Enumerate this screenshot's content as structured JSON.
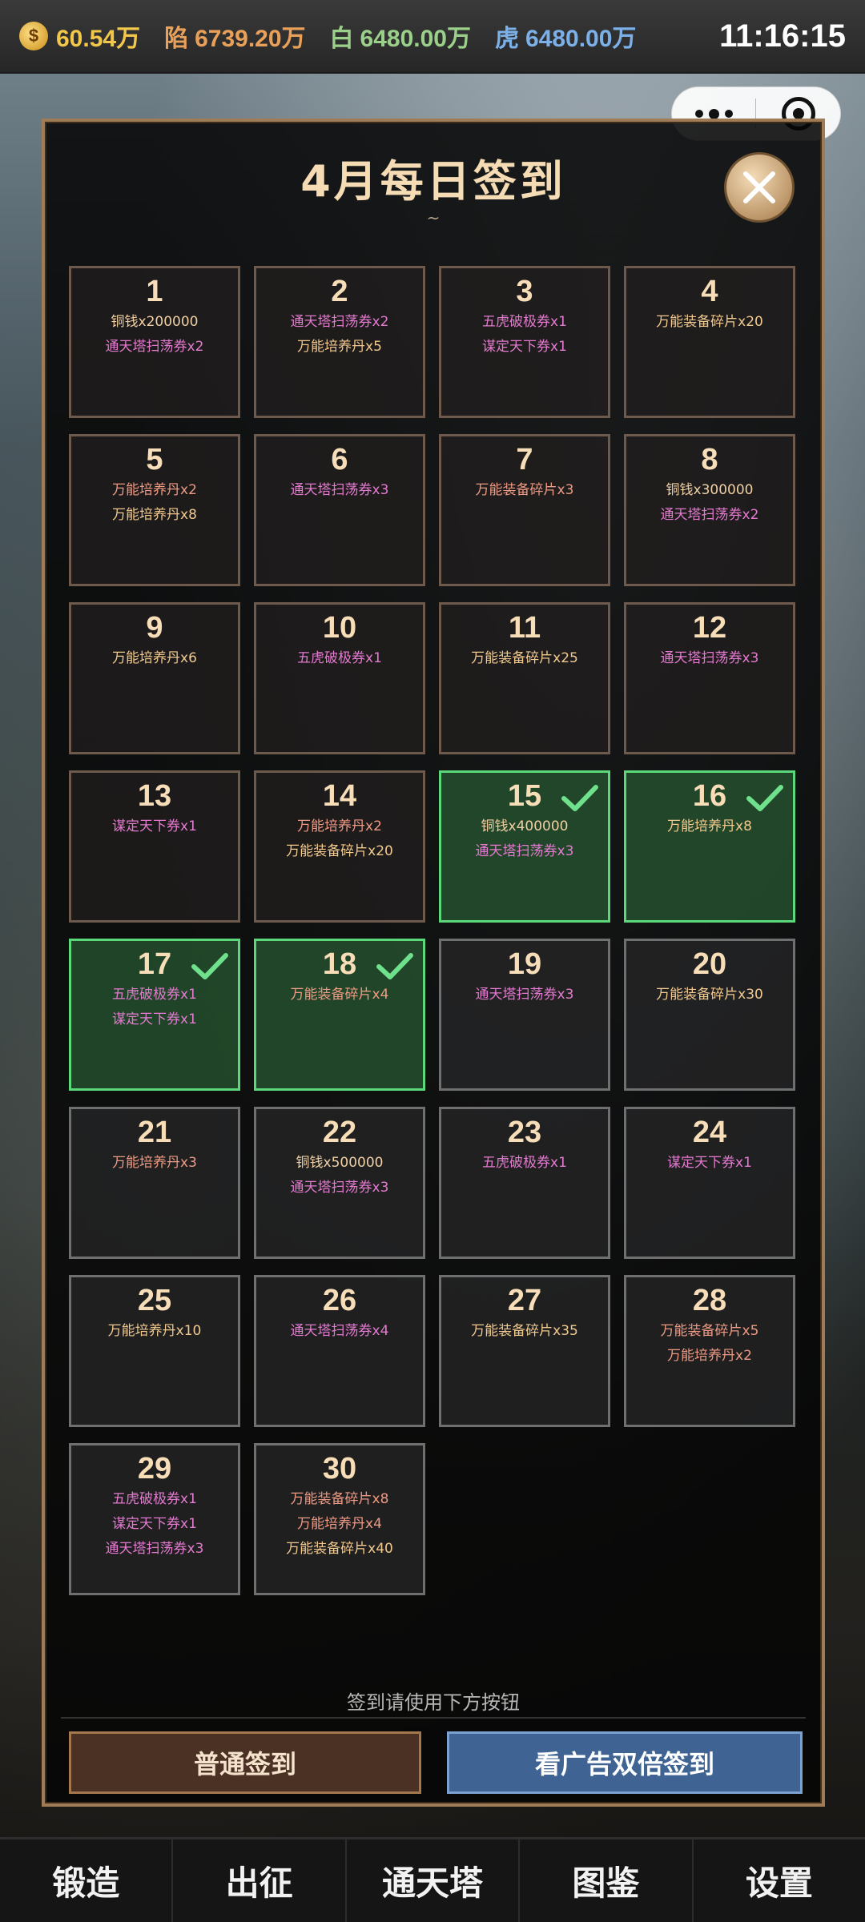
{
  "status": {
    "gold": "60.54万",
    "stats": [
      {
        "key": "陷",
        "value": "6739.20万",
        "color": "orange"
      },
      {
        "key": "白",
        "value": "6480.00万",
        "color": "green"
      },
      {
        "key": "虎",
        "value": "6480.00万",
        "color": "blue"
      }
    ],
    "time": "11:16:15"
  },
  "dialog": {
    "title": "4月每日签到",
    "tilde": "~",
    "hint": "签到请使用下方按钮",
    "btn_normal": "普通签到",
    "btn_ad": "看广告双倍签到"
  },
  "days": [
    {
      "day": "1",
      "state": "past",
      "rewards": [
        {
          "t": "铜钱x200000",
          "c": "copper"
        },
        {
          "t": "通天塔扫荡券x2",
          "c": "pink"
        }
      ]
    },
    {
      "day": "2",
      "state": "past",
      "rewards": [
        {
          "t": "通天塔扫荡券x2",
          "c": "pink"
        },
        {
          "t": "万能培养丹x5",
          "c": "gold"
        }
      ]
    },
    {
      "day": "3",
      "state": "past",
      "rewards": [
        {
          "t": "五虎破极券x1",
          "c": "pink"
        },
        {
          "t": "谋定天下券x1",
          "c": "pink"
        }
      ]
    },
    {
      "day": "4",
      "state": "past",
      "rewards": [
        {
          "t": "万能装备碎片x20",
          "c": "gold"
        }
      ]
    },
    {
      "day": "5",
      "state": "past",
      "rewards": [
        {
          "t": "万能培养丹x2",
          "c": "salmon"
        },
        {
          "t": "万能培养丹x8",
          "c": "gold"
        }
      ]
    },
    {
      "day": "6",
      "state": "past",
      "rewards": [
        {
          "t": "通天塔扫荡券x3",
          "c": "pink"
        }
      ]
    },
    {
      "day": "7",
      "state": "past",
      "rewards": [
        {
          "t": "万能装备碎片x3",
          "c": "salmon"
        }
      ]
    },
    {
      "day": "8",
      "state": "past",
      "rewards": [
        {
          "t": "铜钱x300000",
          "c": "copper"
        },
        {
          "t": "通天塔扫荡券x2",
          "c": "pink"
        }
      ]
    },
    {
      "day": "9",
      "state": "past",
      "rewards": [
        {
          "t": "万能培养丹x6",
          "c": "gold"
        }
      ]
    },
    {
      "day": "10",
      "state": "past",
      "rewards": [
        {
          "t": "五虎破极券x1",
          "c": "pink"
        }
      ]
    },
    {
      "day": "11",
      "state": "past",
      "rewards": [
        {
          "t": "万能装备碎片x25",
          "c": "gold"
        }
      ]
    },
    {
      "day": "12",
      "state": "past",
      "rewards": [
        {
          "t": "通天塔扫荡券x3",
          "c": "pink"
        }
      ]
    },
    {
      "day": "13",
      "state": "past",
      "rewards": [
        {
          "t": "谋定天下券x1",
          "c": "pink"
        }
      ]
    },
    {
      "day": "14",
      "state": "past",
      "rewards": [
        {
          "t": "万能培养丹x2",
          "c": "salmon"
        },
        {
          "t": "万能装备碎片x20",
          "c": "gold"
        }
      ]
    },
    {
      "day": "15",
      "state": "signed",
      "rewards": [
        {
          "t": "铜钱x400000",
          "c": "copper"
        },
        {
          "t": "通天塔扫荡券x3",
          "c": "pink"
        }
      ]
    },
    {
      "day": "16",
      "state": "signed",
      "rewards": [
        {
          "t": "万能培养丹x8",
          "c": "gold"
        }
      ]
    },
    {
      "day": "17",
      "state": "signed",
      "rewards": [
        {
          "t": "五虎破极券x1",
          "c": "pink"
        },
        {
          "t": "谋定天下券x1",
          "c": "pink"
        }
      ]
    },
    {
      "day": "18",
      "state": "signed",
      "rewards": [
        {
          "t": "万能装备碎片x4",
          "c": "salmon"
        }
      ]
    },
    {
      "day": "19",
      "state": "future",
      "rewards": [
        {
          "t": "通天塔扫荡券x3",
          "c": "pink"
        }
      ]
    },
    {
      "day": "20",
      "state": "future",
      "rewards": [
        {
          "t": "万能装备碎片x30",
          "c": "gold"
        }
      ]
    },
    {
      "day": "21",
      "state": "future",
      "rewards": [
        {
          "t": "万能培养丹x3",
          "c": "salmon"
        }
      ]
    },
    {
      "day": "22",
      "state": "future",
      "rewards": [
        {
          "t": "铜钱x500000",
          "c": "copper"
        },
        {
          "t": "通天塔扫荡券x3",
          "c": "pink"
        }
      ]
    },
    {
      "day": "23",
      "state": "future",
      "rewards": [
        {
          "t": "五虎破极券x1",
          "c": "pink"
        }
      ]
    },
    {
      "day": "24",
      "state": "future",
      "rewards": [
        {
          "t": "谋定天下券x1",
          "c": "pink"
        }
      ]
    },
    {
      "day": "25",
      "state": "future",
      "rewards": [
        {
          "t": "万能培养丹x10",
          "c": "gold"
        }
      ]
    },
    {
      "day": "26",
      "state": "future",
      "rewards": [
        {
          "t": "通天塔扫荡券x4",
          "c": "pink"
        }
      ]
    },
    {
      "day": "27",
      "state": "future",
      "rewards": [
        {
          "t": "万能装备碎片x35",
          "c": "gold"
        }
      ]
    },
    {
      "day": "28",
      "state": "future",
      "rewards": [
        {
          "t": "万能装备碎片x5",
          "c": "salmon"
        },
        {
          "t": "万能培养丹x2",
          "c": "salmon"
        }
      ]
    },
    {
      "day": "29",
      "state": "future",
      "rewards": [
        {
          "t": "五虎破极券x1",
          "c": "pink"
        },
        {
          "t": "谋定天下券x1",
          "c": "pink"
        },
        {
          "t": "通天塔扫荡券x3",
          "c": "pink"
        }
      ]
    },
    {
      "day": "30",
      "state": "future",
      "rewards": [
        {
          "t": "万能装备碎片x8",
          "c": "salmon"
        },
        {
          "t": "万能培养丹x4",
          "c": "salmon"
        },
        {
          "t": "万能装备碎片x40",
          "c": "gold"
        }
      ]
    }
  ],
  "nav": [
    "锻造",
    "出征",
    "通天塔",
    "图鉴",
    "设置"
  ]
}
